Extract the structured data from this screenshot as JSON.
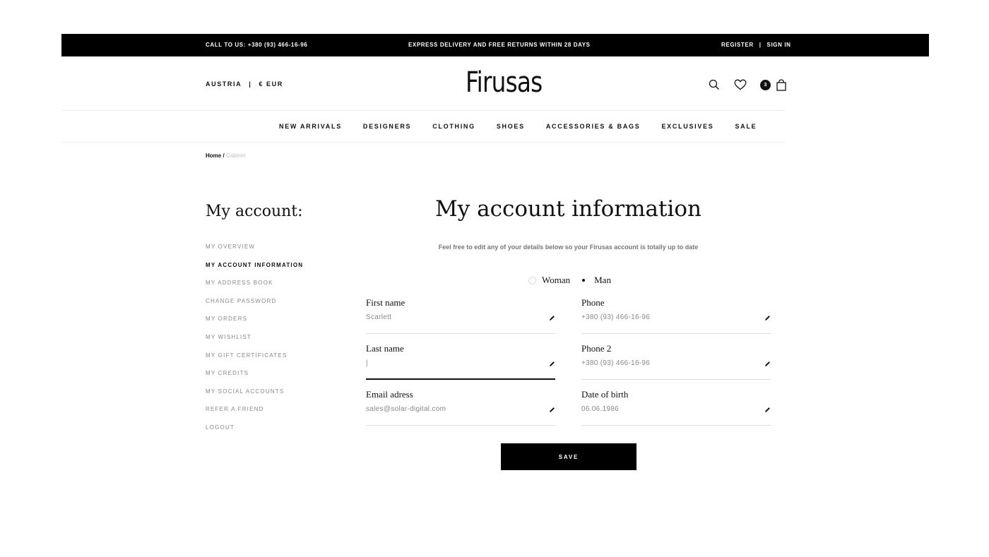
{
  "topbar": {
    "call": "CALL TO US:  +380 (93) 466-16-96",
    "express": "EXPRESS DELIVERY AND FREE RETURNS WITHIN 28 DAYS",
    "register": "REGISTER",
    "separator": "|",
    "sign_in": "SIGN IN"
  },
  "header": {
    "country": "AUSTRIA",
    "separator": "|",
    "currency": "€ EUR",
    "logo": "Firusas",
    "cart_count": "3",
    "icons": [
      "search-icon",
      "heart-icon",
      "bag-icon"
    ]
  },
  "nav": {
    "items": [
      "NEW ARRIVALS",
      "DESIGNERS",
      "CLOTHING",
      "SHOES",
      "ACCESSORIES & BAGS",
      "EXCLUSIVES",
      "SALE"
    ]
  },
  "breadcrumb": {
    "home": "Home /",
    "current": "Cabinet"
  },
  "sidebar": {
    "title": "My account:",
    "items": [
      "MY OVERVIEW",
      "MY ACCOUNT INFORMATION",
      "MY ADDRESS BOOK",
      "CHANGE PASSWORD",
      "MY ORDERS",
      "MY WISHLIST",
      "MY GIFT CERTIFICATES",
      "MY CREDITS",
      "MY SOCIAL ACCOUNTS",
      "REFER A FRIEND",
      "LOGOUT"
    ],
    "active_index": 1
  },
  "main": {
    "title": "My account information",
    "subtitle": "Feel free to edit any of your details below so your Firusas account is totally up to date",
    "gender": {
      "woman": "Woman",
      "man": "Man",
      "selected": "Man"
    },
    "fields": {
      "first_name": {
        "label": "First name",
        "value": "Scarlett"
      },
      "last_name": {
        "label": "Last name",
        "value": "|"
      },
      "email": {
        "label": "Email adress",
        "value": "sales@solar-digital.com"
      },
      "phone": {
        "label": "Phone",
        "value": "+380 (93) 466-16-96"
      },
      "phone2": {
        "label": "Phone 2",
        "value": "+380 (93) 466-16-96"
      },
      "dob": {
        "label": "Date of  birth",
        "value": "06.06.1986"
      }
    },
    "save_label": "SAVE"
  },
  "colors": {
    "topbar_bg": "#000000",
    "accent": "#111111",
    "muted": "#888888"
  }
}
